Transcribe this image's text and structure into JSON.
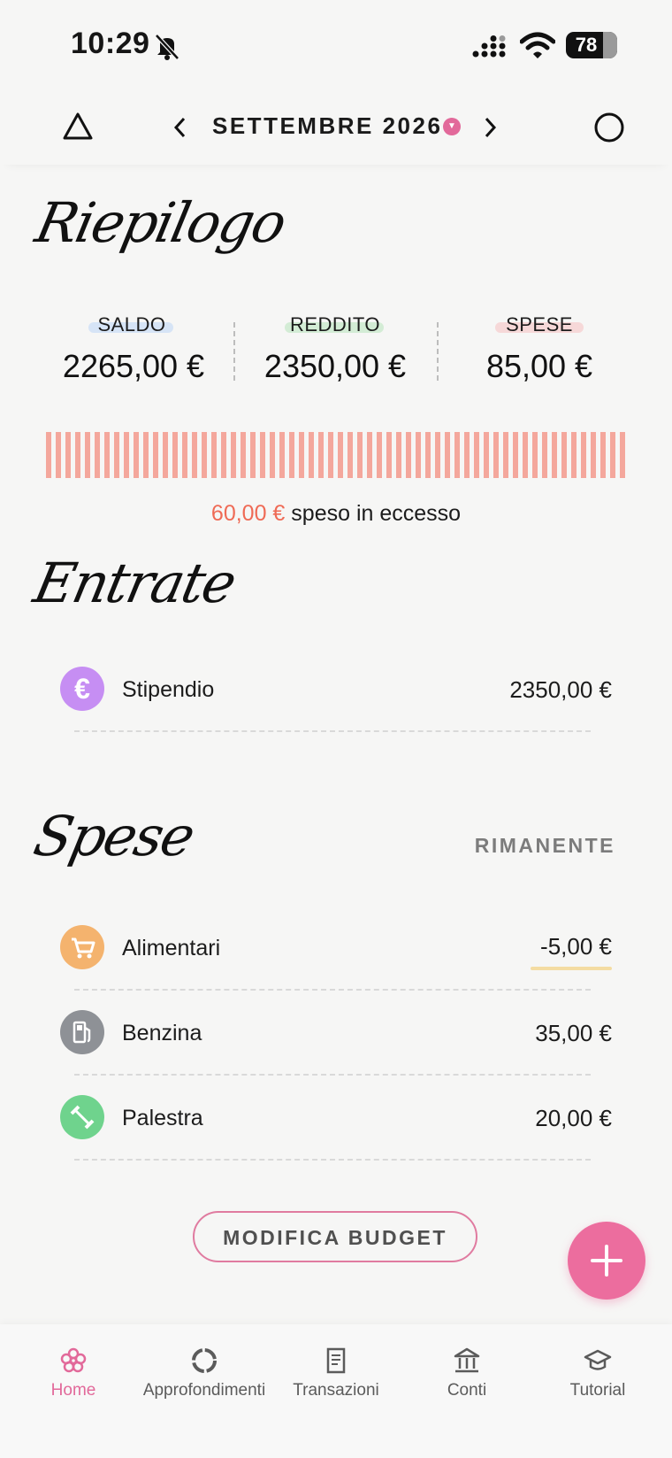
{
  "status_bar": {
    "time": "10:29",
    "battery": "78"
  },
  "header": {
    "month": "SETTEMBRE 2026"
  },
  "summary": {
    "title": "Riepilogo",
    "balance_label": "SALDO",
    "balance_value": "2265,00 €",
    "income_label": "REDDITO",
    "income_value": "2350,00 €",
    "expenses_label": "SPESE",
    "expenses_value": "85,00 €",
    "excess_amount": "60,00 €",
    "excess_text": "speso in eccesso"
  },
  "income": {
    "title": "Entrate",
    "items": [
      {
        "name": "Stipendio",
        "value": "2350,00 €",
        "icon": "euro-icon",
        "color": "#c68ef3"
      }
    ]
  },
  "expenses": {
    "title": "Spese",
    "remaining_label": "RIMANENTE",
    "items": [
      {
        "name": "Alimentari",
        "value": "-5,00 €",
        "icon": "cart-icon",
        "color": "#f4b36e"
      },
      {
        "name": "Benzina",
        "value": "35,00 €",
        "icon": "fuel-icon",
        "color": "#8e9196"
      },
      {
        "name": "Palestra",
        "value": "20,00 €",
        "icon": "dumbbell-icon",
        "color": "#6fd38d"
      }
    ]
  },
  "actions": {
    "edit_budget": "MODIFICA BUDGET"
  },
  "tabs": [
    {
      "label": "Home",
      "icon": "flower-icon"
    },
    {
      "label": "Approfondimenti",
      "icon": "donut-chart-icon"
    },
    {
      "label": "Transazioni",
      "icon": "receipt-icon"
    },
    {
      "label": "Conti",
      "icon": "bank-icon"
    },
    {
      "label": "Tutorial",
      "icon": "graduation-cap-icon"
    }
  ],
  "colors": {
    "accent": "#e2699a",
    "over_budget": "#ef6a55",
    "bar": "#f4a79c"
  }
}
